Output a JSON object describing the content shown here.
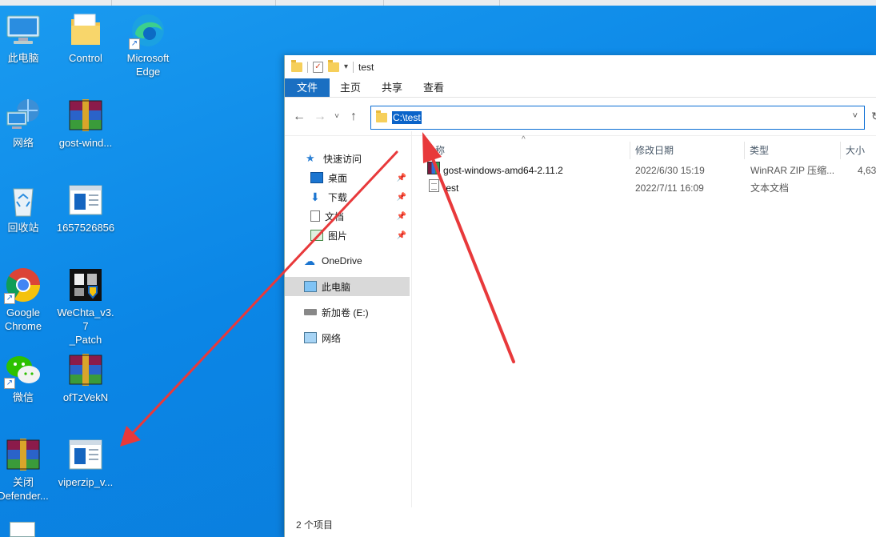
{
  "desktop": {
    "icons": [
      {
        "label": "此电脑",
        "icon": "this-pc-icon"
      },
      {
        "label": "Control",
        "icon": "folder-icon"
      },
      {
        "label": "Microsoft\nEdge",
        "icon": "edge-icon"
      },
      {
        "label": "网络",
        "icon": "network-icon"
      },
      {
        "label": "gost-wind...",
        "icon": "winrar-icon"
      },
      {
        "label": "回收站",
        "icon": "recycle-bin-icon"
      },
      {
        "label": "1657526856",
        "icon": "window-file-icon"
      },
      {
        "label": "Google\nChrome",
        "icon": "chrome-icon"
      },
      {
        "label": "WeChta_v3.7\n_Patch",
        "icon": "patch-icon"
      },
      {
        "label": "微信",
        "icon": "wechat-icon"
      },
      {
        "label": "ofTzVekN",
        "icon": "winrar-icon"
      },
      {
        "label": "关闭\nDefender...",
        "icon": "winrar-icon"
      },
      {
        "label": "viperzip_v...",
        "icon": "window-file-icon"
      }
    ]
  },
  "explorer": {
    "title": "test",
    "ribbon_tabs": [
      "文件",
      "主页",
      "共享",
      "查看"
    ],
    "address": "C:\\test",
    "nav": {
      "quick_access": "快速访问",
      "desktop": "桌面",
      "downloads": "下载",
      "documents": "文档",
      "pictures": "图片",
      "onedrive": "OneDrive",
      "this_pc": "此电脑",
      "drive_e": "新加卷 (E:)",
      "network": "网络"
    },
    "columns": [
      "名称",
      "修改日期",
      "类型",
      "大小"
    ],
    "files": [
      {
        "name": "gost-windows-amd64-2.11.2",
        "modified": "2022/6/30 15:19",
        "type": "WinRAR ZIP 压缩...",
        "size": "4,63",
        "icon": "winrar-icon"
      },
      {
        "name": "test",
        "modified": "2022/7/11 16:09",
        "type": "文本文档",
        "size": "",
        "icon": "text-file-icon"
      }
    ],
    "status": "2 个项目"
  },
  "colors": {
    "accent": "#1a6fc2",
    "arrow": "#e8393b",
    "desktop_bg": "#0b86e6"
  }
}
